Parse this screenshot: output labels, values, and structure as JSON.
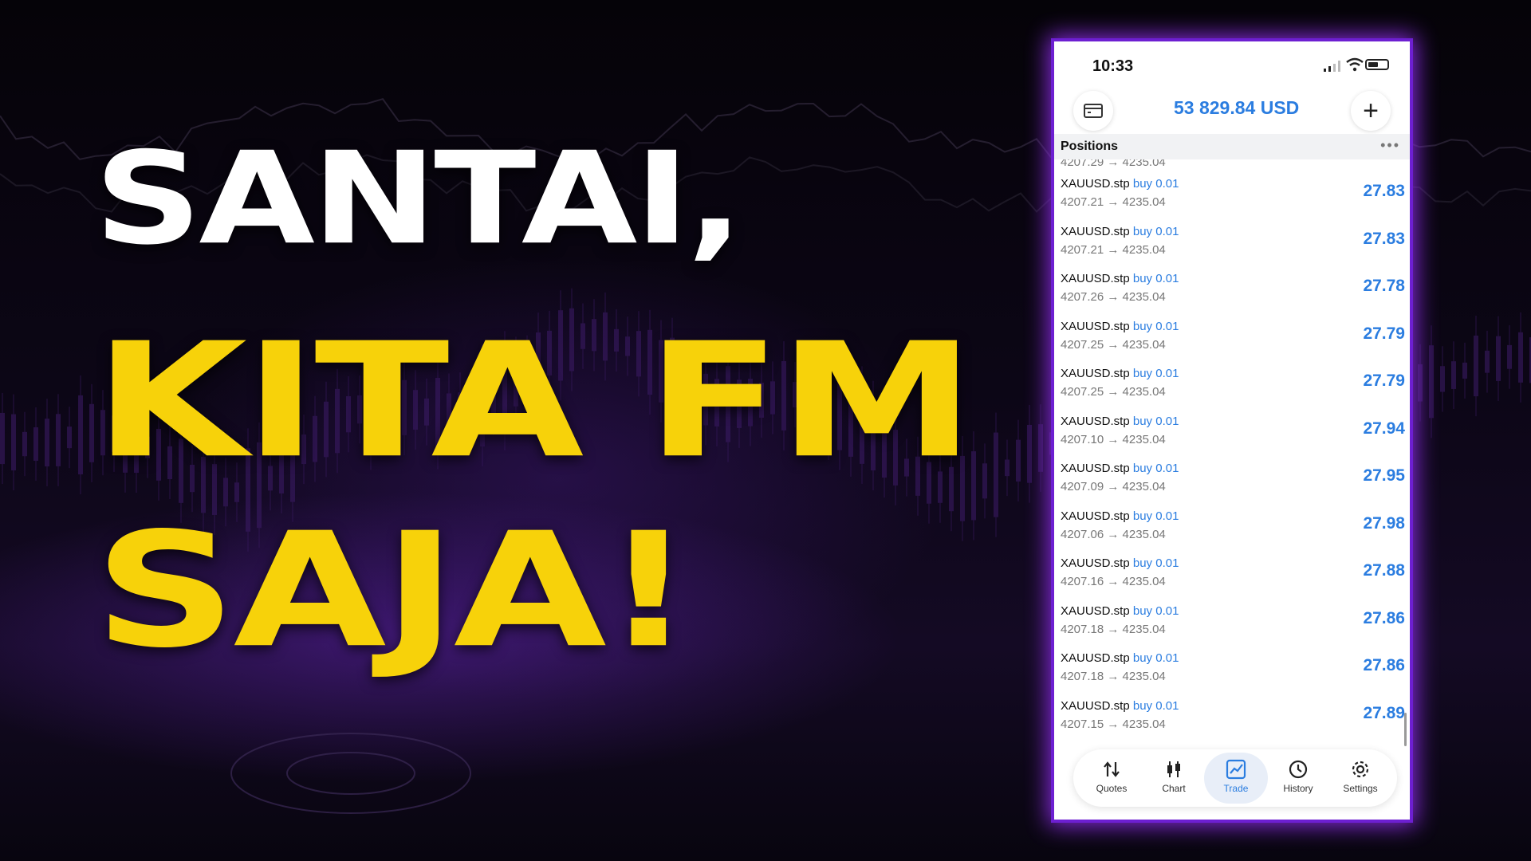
{
  "headline": {
    "line1": "SANTAI,",
    "line2": "KITA FM",
    "line3": "SAJA!"
  },
  "colors": {
    "headline_white": "#ffffff",
    "headline_yellow": "#f7d20a",
    "phone_border": "#8a2be2",
    "accent_blue": "#2b7de0"
  },
  "phone": {
    "status": {
      "time": "10:33"
    },
    "account": {
      "balance": "53 829.84 USD"
    },
    "positions_title": "Positions",
    "partial_row_text": "4207.29 → 4235.04",
    "positions": [
      {
        "symbol": "XAUUSD.stp",
        "side": "buy 0.01",
        "prices": "4207.21 → 4235.04",
        "pl": "27.83"
      },
      {
        "symbol": "XAUUSD.stp",
        "side": "buy 0.01",
        "prices": "4207.21 → 4235.04",
        "pl": "27.83"
      },
      {
        "symbol": "XAUUSD.stp",
        "side": "buy 0.01",
        "prices": "4207.26 → 4235.04",
        "pl": "27.78"
      },
      {
        "symbol": "XAUUSD.stp",
        "side": "buy 0.01",
        "prices": "4207.25 → 4235.04",
        "pl": "27.79"
      },
      {
        "symbol": "XAUUSD.stp",
        "side": "buy 0.01",
        "prices": "4207.25 → 4235.04",
        "pl": "27.79"
      },
      {
        "symbol": "XAUUSD.stp",
        "side": "buy 0.01",
        "prices": "4207.10 → 4235.04",
        "pl": "27.94"
      },
      {
        "symbol": "XAUUSD.stp",
        "side": "buy 0.01",
        "prices": "4207.09 → 4235.04",
        "pl": "27.95"
      },
      {
        "symbol": "XAUUSD.stp",
        "side": "buy 0.01",
        "prices": "4207.06 → 4235.04",
        "pl": "27.98"
      },
      {
        "symbol": "XAUUSD.stp",
        "side": "buy 0.01",
        "prices": "4207.16 → 4235.04",
        "pl": "27.88"
      },
      {
        "symbol": "XAUUSD.stp",
        "side": "buy 0.01",
        "prices": "4207.18 → 4235.04",
        "pl": "27.86"
      },
      {
        "symbol": "XAUUSD.stp",
        "side": "buy 0.01",
        "prices": "4207.18 → 4235.04",
        "pl": "27.86"
      },
      {
        "symbol": "XAUUSD.stp",
        "side": "buy 0.01",
        "prices": "4207.15 → 4235.04",
        "pl": "27.89"
      }
    ],
    "tabs": [
      {
        "label": "Quotes",
        "icon": "quotes-icon"
      },
      {
        "label": "Chart",
        "icon": "candlestick-chart-icon"
      },
      {
        "label": "Trade",
        "icon": "trade-chart-icon",
        "active": true
      },
      {
        "label": "History",
        "icon": "history-clock-icon"
      },
      {
        "label": "Settings",
        "icon": "gear-icon"
      }
    ]
  }
}
